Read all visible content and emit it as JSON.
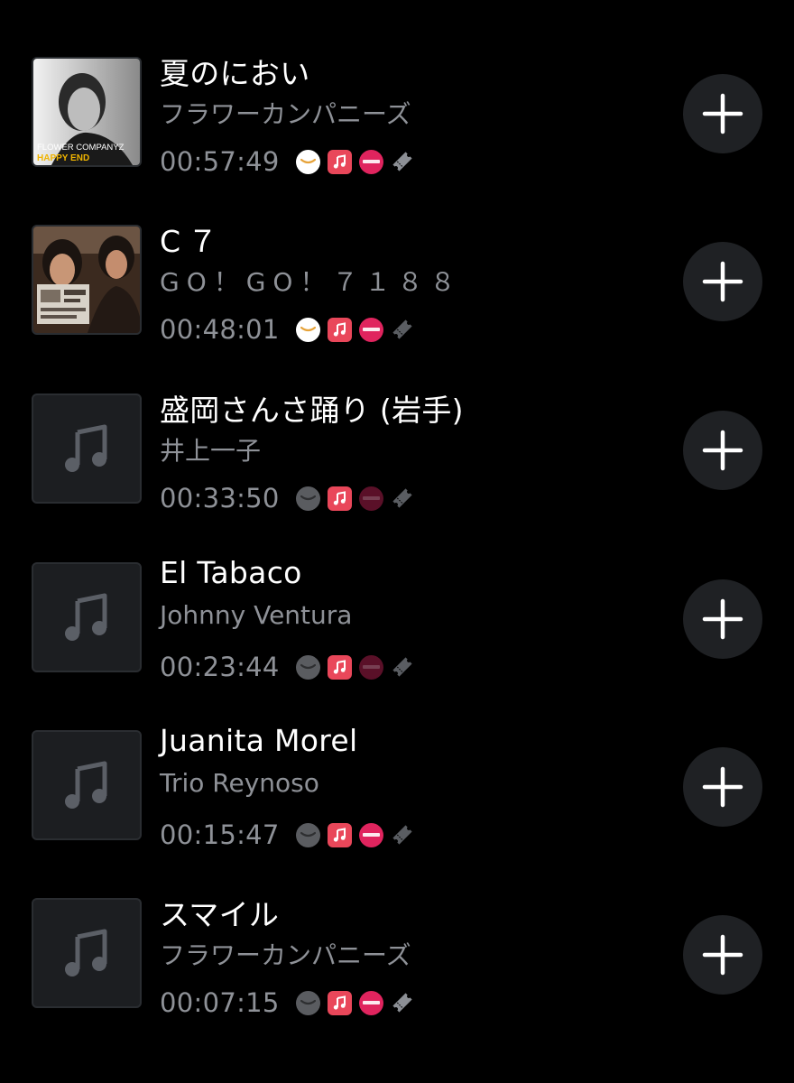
{
  "tracks": [
    {
      "title": "夏のにおい",
      "artist": "フラワーカンパニーズ",
      "time": "00:57:49",
      "art": "cover",
      "art_text_1": "FLOWER COMPANYZ",
      "art_text_2": "HAPPY END",
      "rec_active": true,
      "amazon_active": true
    },
    {
      "title": "C７",
      "artist": "GO！GO！７１８８",
      "time": "00:48:01",
      "art": "cover",
      "rec_active": true,
      "amazon_active": true
    },
    {
      "title": "盛岡さんさ踊り (岩手)",
      "artist": "井上一子",
      "time": "00:33:50",
      "art": "placeholder",
      "rec_active": false,
      "amazon_active": false
    },
    {
      "title": "El Tabaco",
      "artist": "Johnny Ventura",
      "time": "00:23:44",
      "art": "placeholder",
      "rec_active": false,
      "amazon_active": false
    },
    {
      "title": "Juanita Morel",
      "artist": "Trio Reynoso",
      "time": "00:15:47",
      "art": "placeholder",
      "rec_active": true,
      "amazon_active": false
    },
    {
      "title": "スマイル",
      "artist": "フラワーカンパニーズ",
      "time": "00:07:15",
      "art": "placeholder",
      "rec_active": true,
      "amazon_active": false
    }
  ],
  "icons": {
    "amazon": "amazon-music-icon",
    "apple_music": "apple-music-icon",
    "recochoku": "recochoku-icon",
    "ticket": "ticket-icon",
    "add": "plus-icon",
    "placeholder": "music-note-icon"
  },
  "colors": {
    "background": "#000000",
    "title": "#ffffff",
    "secondary": "#8e9197",
    "apple_music": "#e9475a",
    "recochoku": "#e0245e",
    "add_button_bg": "#1f2124"
  }
}
